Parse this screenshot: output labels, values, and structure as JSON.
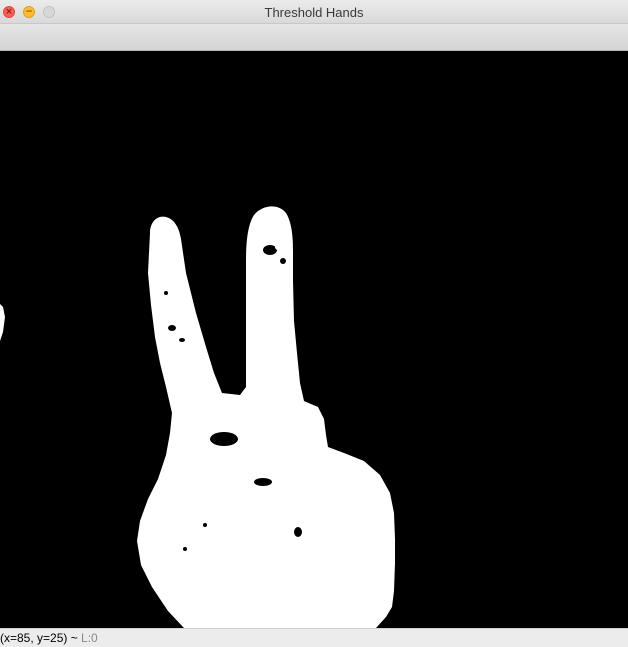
{
  "window": {
    "title": "Threshold Hands",
    "close_glyph": "×",
    "minimize_glyph": "−"
  },
  "image": {
    "description_icon": "threshold-mask-image",
    "foreground_color": "#ffffff",
    "background_color": "#000000"
  },
  "status": {
    "coords": "(x=85, y=25) ~ ",
    "level": "L:0"
  }
}
